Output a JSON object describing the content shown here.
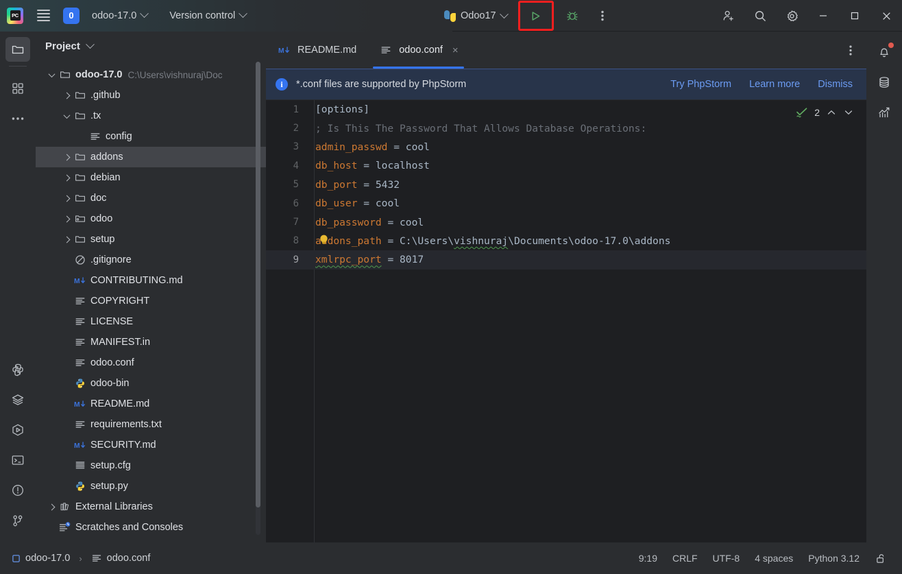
{
  "titlebar": {
    "logo_icon": "pycharm-logo-icon",
    "menu_icon": "hamburger-menu-icon",
    "project_badge": "0",
    "project_name": "odoo-17.0",
    "version_control": "Version control",
    "run_config_name": "Odoo17",
    "run_icon": "run-play-icon",
    "debug_icon": "debug-bug-icon",
    "more_icon": "more-vertical-icon",
    "add_user_icon": "add-user-icon",
    "search_icon": "search-icon",
    "settings_icon": "gear-icon",
    "minimize_icon": "minimize-icon",
    "maximize_icon": "maximize-icon",
    "close_icon": "close-icon",
    "run_highlight_color": "#f81f1f",
    "accent_color": "#3574f0"
  },
  "left_rail": [
    {
      "name": "project-tool-window",
      "icon": "folder-icon",
      "active": true
    },
    {
      "name": "structure-tool-window",
      "icon": "grid-blocks-icon",
      "active": false
    },
    {
      "name": "more-tool-windows",
      "icon": "ellipsis-icon",
      "active": false
    },
    {
      "name": "python-packages",
      "icon": "python-icon",
      "active": false
    },
    {
      "name": "database-layers",
      "icon": "layers-icon",
      "active": false
    },
    {
      "name": "run-tool-window",
      "icon": "run-hexagon-icon",
      "active": false
    },
    {
      "name": "terminal-tool-window",
      "icon": "terminal-icon",
      "active": false
    },
    {
      "name": "problems-tool-window",
      "icon": "warning-circle-icon",
      "active": false
    },
    {
      "name": "version-control-tool-window",
      "icon": "git-branch-icon",
      "active": false
    }
  ],
  "right_rail": [
    {
      "name": "notifications",
      "icon": "bell-icon",
      "badge": true
    },
    {
      "name": "database",
      "icon": "database-icon",
      "badge": false
    },
    {
      "name": "profiler",
      "icon": "chart-bars-icon",
      "badge": false
    }
  ],
  "project_panel": {
    "title": "Project",
    "tree": [
      {
        "label": "odoo-17.0",
        "path": "C:\\Users\\vishnuraj\\Doc",
        "icon": "folder-icon",
        "arrow": "down",
        "indent": 0,
        "bold": true,
        "selected": false
      },
      {
        "label": ".github",
        "path": "",
        "icon": "folder-icon",
        "arrow": "right",
        "indent": 1,
        "bold": false,
        "selected": false
      },
      {
        "label": ".tx",
        "path": "",
        "icon": "folder-icon",
        "arrow": "down",
        "indent": 1,
        "bold": false,
        "selected": false
      },
      {
        "label": "config",
        "path": "",
        "icon": "text-file-icon",
        "arrow": "none",
        "indent": 2,
        "bold": false,
        "selected": false
      },
      {
        "label": "addons",
        "path": "",
        "icon": "folder-icon",
        "arrow": "right",
        "indent": 1,
        "bold": false,
        "selected": true
      },
      {
        "label": "debian",
        "path": "",
        "icon": "folder-icon",
        "arrow": "right",
        "indent": 1,
        "bold": false,
        "selected": false
      },
      {
        "label": "doc",
        "path": "",
        "icon": "folder-icon",
        "arrow": "right",
        "indent": 1,
        "bold": false,
        "selected": false
      },
      {
        "label": "odoo",
        "path": "",
        "icon": "source-folder-icon",
        "arrow": "right",
        "indent": 1,
        "bold": false,
        "selected": false
      },
      {
        "label": "setup",
        "path": "",
        "icon": "folder-icon",
        "arrow": "right",
        "indent": 1,
        "bold": false,
        "selected": false
      },
      {
        "label": ".gitignore",
        "path": "",
        "icon": "gitignore-icon",
        "arrow": "none",
        "indent": 1,
        "bold": false,
        "selected": false
      },
      {
        "label": "CONTRIBUTING.md",
        "path": "",
        "icon": "markdown-icon",
        "arrow": "none",
        "indent": 1,
        "bold": false,
        "selected": false
      },
      {
        "label": "COPYRIGHT",
        "path": "",
        "icon": "text-file-icon",
        "arrow": "none",
        "indent": 1,
        "bold": false,
        "selected": false
      },
      {
        "label": "LICENSE",
        "path": "",
        "icon": "text-file-icon",
        "arrow": "none",
        "indent": 1,
        "bold": false,
        "selected": false
      },
      {
        "label": "MANIFEST.in",
        "path": "",
        "icon": "text-file-icon",
        "arrow": "none",
        "indent": 1,
        "bold": false,
        "selected": false
      },
      {
        "label": "odoo.conf",
        "path": "",
        "icon": "text-file-icon",
        "arrow": "none",
        "indent": 1,
        "bold": false,
        "selected": false
      },
      {
        "label": "odoo-bin",
        "path": "",
        "icon": "python-icon",
        "arrow": "none",
        "indent": 1,
        "bold": false,
        "selected": false
      },
      {
        "label": "README.md",
        "path": "",
        "icon": "markdown-icon",
        "arrow": "none",
        "indent": 1,
        "bold": false,
        "selected": false
      },
      {
        "label": "requirements.txt",
        "path": "",
        "icon": "text-file-icon",
        "arrow": "none",
        "indent": 1,
        "bold": false,
        "selected": false
      },
      {
        "label": "SECURITY.md",
        "path": "",
        "icon": "markdown-icon",
        "arrow": "none",
        "indent": 1,
        "bold": false,
        "selected": false
      },
      {
        "label": "setup.cfg",
        "path": "",
        "icon": "config-file-icon",
        "arrow": "none",
        "indent": 1,
        "bold": false,
        "selected": false
      },
      {
        "label": "setup.py",
        "path": "",
        "icon": "python-icon",
        "arrow": "none",
        "indent": 1,
        "bold": false,
        "selected": false
      },
      {
        "label": "External Libraries",
        "path": "",
        "icon": "library-icon",
        "arrow": "right",
        "indent": 0,
        "bold": false,
        "selected": false
      },
      {
        "label": "Scratches and Consoles",
        "path": "",
        "icon": "scratches-icon",
        "arrow": "none",
        "indent": 0,
        "bold": false,
        "selected": false
      }
    ]
  },
  "editor": {
    "tabs": [
      {
        "label": "README.md",
        "icon": "markdown-icon",
        "active": false,
        "closable": false
      },
      {
        "label": "odoo.conf",
        "icon": "text-file-icon",
        "active": true,
        "closable": true,
        "close_label": "×"
      }
    ],
    "tabs_more_icon": "more-vertical-icon",
    "banner": {
      "icon": "info-icon",
      "message": "*.conf files are supported by PhpStorm",
      "actions": [
        "Try PhpStorm",
        "Learn more",
        "Dismiss"
      ]
    },
    "inspection": {
      "icon": "inspection-check-icon",
      "count": "2",
      "up_icon": "chevron-up-icon",
      "down_icon": "chevron-down-icon"
    },
    "bulb_icon": "intention-bulb-icon",
    "lines": [
      {
        "n": "1",
        "text": "[options]",
        "kind": "section",
        "current": false
      },
      {
        "n": "2",
        "text": "; Is This The Password That Allows Database Operations:",
        "kind": "comment",
        "current": false
      },
      {
        "n": "3",
        "key": "admin_passwd",
        "value": "cool",
        "kind": "kv",
        "current": false
      },
      {
        "n": "4",
        "key": "db_host",
        "value": "localhost",
        "kind": "kv",
        "current": false
      },
      {
        "n": "5",
        "key": "db_port",
        "value": "5432",
        "kind": "kv",
        "current": false
      },
      {
        "n": "6",
        "key": "db_user",
        "value": "cool",
        "kind": "kv",
        "current": false
      },
      {
        "n": "7",
        "key": "db_password",
        "value": "cool",
        "kind": "kv",
        "current": false
      },
      {
        "n": "8",
        "key": "addons_path",
        "value": "C:\\Users\\vishnuraj\\Documents\\odoo-17.0\\addons",
        "kind": "kv",
        "current": false
      },
      {
        "n": "9",
        "key": "xmlrpc_port",
        "value": "8017",
        "kind": "kv",
        "current": true
      }
    ]
  },
  "status_bar": {
    "breadcrumb": [
      {
        "label": "odoo-17.0",
        "icon": "module-icon"
      },
      {
        "label": "odoo.conf",
        "icon": "text-file-icon"
      }
    ],
    "separator": "›",
    "caret_position": "9:19",
    "line_separator": "CRLF",
    "encoding": "UTF-8",
    "indent": "4 spaces",
    "interpreter": "Python 3.12",
    "lock_icon": "unlocked-icon"
  }
}
